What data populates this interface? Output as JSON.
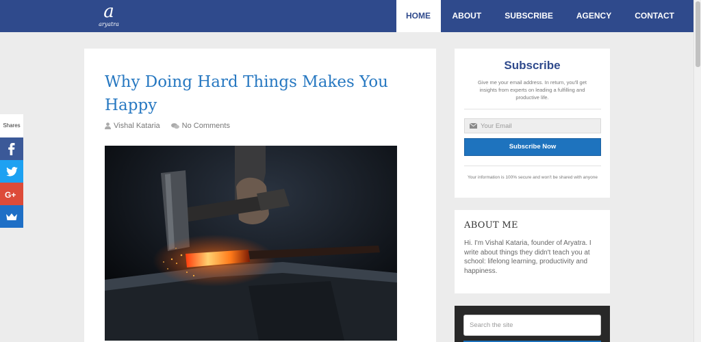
{
  "brand": {
    "logo_mark": "a",
    "logo_text": "aryatra"
  },
  "nav": {
    "items": [
      {
        "label": "HOME",
        "active": true
      },
      {
        "label": "ABOUT"
      },
      {
        "label": "SUBSCRIBE"
      },
      {
        "label": "AGENCY"
      },
      {
        "label": "CONTACT"
      }
    ]
  },
  "share": {
    "label": "Shares",
    "buttons": [
      {
        "icon": "facebook-icon",
        "color": "#3b5998"
      },
      {
        "icon": "twitter-icon",
        "color": "#1da1f2"
      },
      {
        "icon": "google-plus-icon",
        "color": "#dd4b39"
      },
      {
        "icon": "sumo-crown-icon",
        "color": "#1e6fc6"
      }
    ]
  },
  "post": {
    "title": "Why Doing Hard Things Makes You Happy",
    "author": "Vishal Kataria",
    "comments": "No Comments",
    "image_alt": "blacksmith hammering glowing metal on anvil"
  },
  "subscribe": {
    "title": "Subscribe",
    "description": "Give me your email address. In return, you'll get insights from experts on leading a fulfilling and productive life.",
    "email_placeholder": "Your Email",
    "button_label": "Subscribe Now",
    "note": "Your information is 100% secure and won't be shared with anyone"
  },
  "about": {
    "title": "ABOUT ME",
    "text": "Hi. I'm Vishal Kataria, founder of Aryatra. I write about things they didn't teach you at school: lifelong learning, productivity and happiness."
  },
  "search": {
    "placeholder": "Search the site"
  },
  "colors": {
    "header": "#2f4a8c",
    "link": "#2778c1",
    "button": "#1e73be"
  }
}
